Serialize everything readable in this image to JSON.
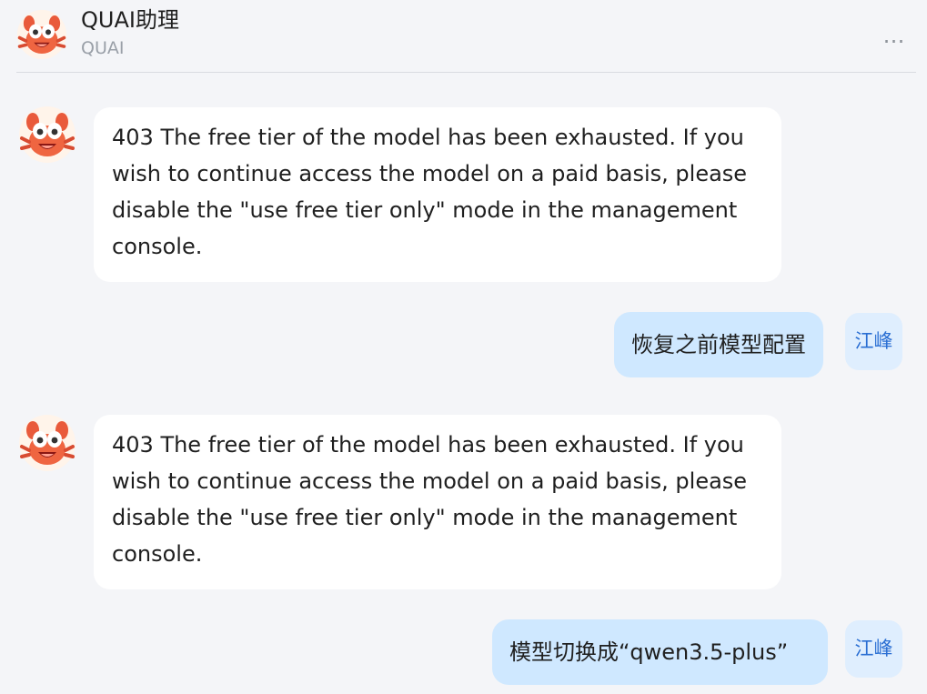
{
  "header": {
    "title": "QUAI助理",
    "subtitle": "QUAI",
    "more_label": "…",
    "avatar_icon": "crab-mascot-icon",
    "more_icon": "more-icon"
  },
  "messages": [
    {
      "role": "assistant",
      "text": "403 The free tier of the model has been exhausted. If you wish to continue access the model on a paid basis, please disable the \"use free tier only\" mode in the management console.",
      "avatar_icon": "crab-mascot-icon"
    },
    {
      "role": "user",
      "text": "恢复之前模型配置",
      "user_name": "江峰"
    },
    {
      "role": "assistant",
      "text": "403 The free tier of the model has been exhausted. If you wish to continue access the model on a paid basis, please disable the \"use free tier only\" mode in the management console.",
      "avatar_icon": "crab-mascot-icon"
    },
    {
      "role": "user",
      "text": "模型切换成“qwen3.5-plus”",
      "user_name": "江峰"
    }
  ],
  "colors": {
    "background": "#f4f5f8",
    "bot_bubble": "#ffffff",
    "user_bubble": "#cfe8ff",
    "user_tag_bg": "#dfeefe",
    "user_tag_text": "#2b6fd3",
    "muted_text": "#9aa0a8"
  }
}
